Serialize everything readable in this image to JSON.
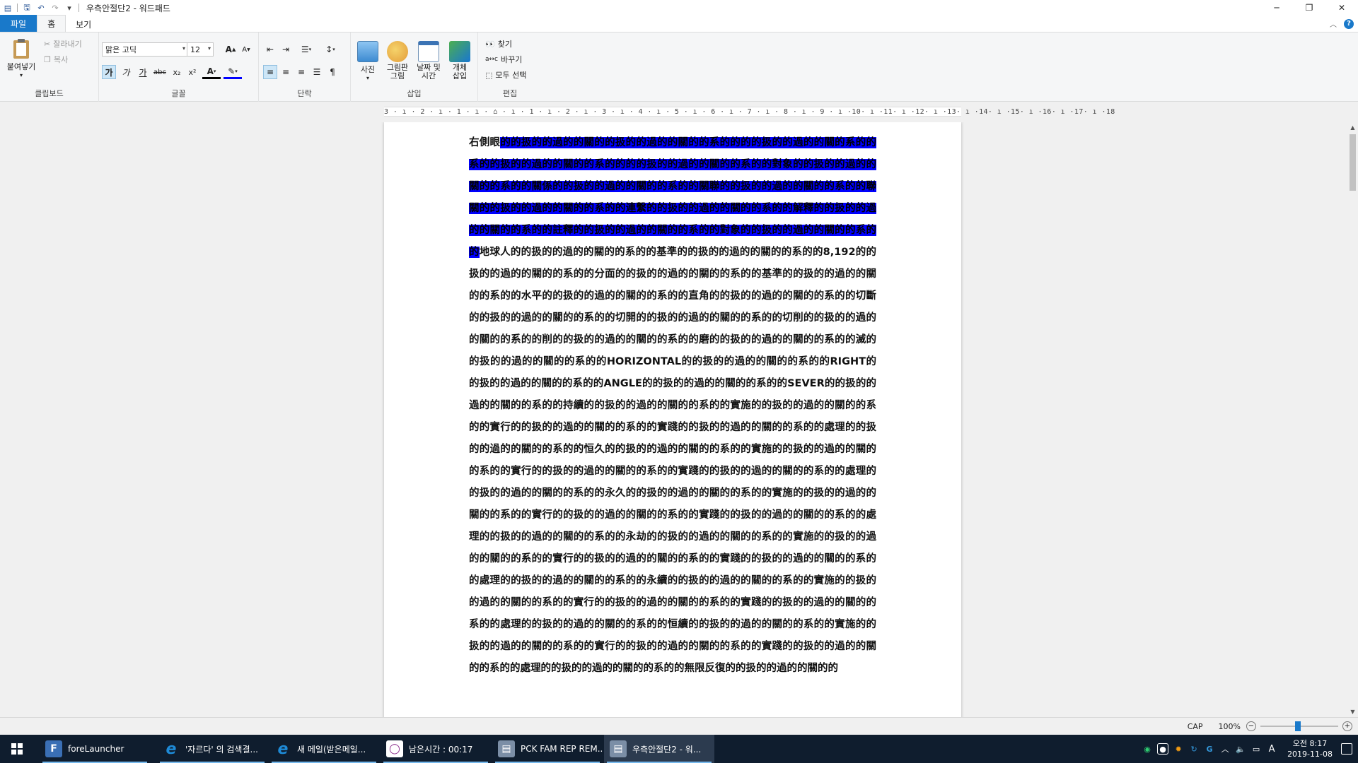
{
  "window": {
    "title": "우측안절단2 - 워드패드",
    "controls": {
      "minimize": "─",
      "maximize": "❐",
      "close": "✕"
    }
  },
  "quick_access": {
    "dropdown": "▾"
  },
  "tabs": [
    {
      "label": "파일"
    },
    {
      "label": "홈"
    },
    {
      "label": "보기"
    }
  ],
  "ribbon": {
    "clipboard": {
      "label": "클립보드",
      "paste": "붙여넣기",
      "cut": "잘라내기",
      "copy": "복사"
    },
    "font": {
      "label": "글꼴",
      "family": "맑은 고딕",
      "size": "12",
      "grow": "A",
      "shrink": "A",
      "bold": "가",
      "italic": "가",
      "underline": "가",
      "strike": "abc",
      "subscript": "x₂",
      "superscript": "x²",
      "color": "A",
      "highlight": "✎"
    },
    "paragraph": {
      "label": "단락"
    },
    "insert": {
      "label": "삽입",
      "picture": "사진",
      "paint": "그림판\n그림",
      "datetime": "날짜 및\n시간",
      "object": "개체\n삽입"
    },
    "edit": {
      "label": "편집",
      "find": "찾기",
      "replace": "바꾸기",
      "select_all": "모두 선택"
    }
  },
  "ruler": {
    "labels": "3 · ı · 2 · ı · 1 · ı · ⌂ · ı · 1 · ı · 2 · ı · 3 · ı · 4 · ı · 5 · ı · 6 · ı · 7 · ı · 8 · ı · 9 · ı ·10· ı ·11· ı ·12· ı ·13· ı ·14· ı ·15· ı ·16· ı ·17· ı ·18"
  },
  "document": {
    "prefix": "右側眼",
    "selected": "的的扱的的過的的關的的扱的的過的的關的的系的的的的扱的的過的的關的系的的系的的扱的的過的的關的的系的的的的扱的的過的的關的的系的的對象的的扱的的過的的關的的系的的關係的的扱的的過的的關的的系的的關聯的的扱的的過的的關的的系的的聯關的的扱的的過的的關的的系的的連繫的的扱的的過的的關的的系的的解釋的的扱的的過的的關的的系的的註釋的的扱的的過的的關的的系的的對象的的扱的的過的的關的的系的的",
    "body": "地球人的的扱的的過的的關的的系的的基準的的扱的的過的的關的的系的的8,192的的扱的的過的的關的的系的的分面的的扱的的過的的關的的系的的基準的的扱的的過的的關的的系的的水平的的扱的的過的的關的的系的的直角的的扱的的過的的關的的系的的切斷的的扱的的過的的關的的系的的切開的的扱的的過的的關的的系的的切削的的扱的的過的的關的的系的的削的的扱的的過的的關的的系的的磨的的扱的的過的的關的的系的的滅的的扱的的過的的關的的系的的HORIZONTAL的的扱的的過的的關的的系的的RIGHT的的扱的的過的的關的的系的的ANGLE的的扱的的過的的關的的系的的SEVER的的扱的的過的的關的的系的的持續的的扱的的過的的關的的系的的實施的的扱的的過的的關的的系的的實行的的扱的的過的的關的的系的的實踐的的扱的的過的的關的的系的的處理的的扱的的過的的關的的系的的恒久的的扱的的過的的關的的系的的實施的的扱的的過的的關的的系的的實行的的扱的的過的的關的的系的的實踐的的扱的的過的的關的的系的的處理的的扱的的過的的關的的系的的永久的的扱的的過的的關的的系的的實施的的扱的的過的的關的的系的的實行的的扱的的過的的關的的系的的實踐的的扱的的過的的關的的系的的處理的的扱的的過的的關的的系的的永劫的的扱的的過的的關的的系的的實施的的扱的的過的的關的的系的的實行的的扱的的過的的關的的系的的實踐的的扱的的過的的關的的系的的處理的的扱的的過的的關的的系的的永續的的扱的的過的的關的的系的的實施的的扱的的過的的關的的系的的實行的的扱的的過的的關的的系的的實踐的的扱的的過的的關的的系的的處理的的扱的的過的的關的的系的的恒續的的扱的的過的的關的的系的的實施的的扱的的過的的關的的系的的實行的的扱的的過的的關的的系的的實踐的的扱的的過的的關的的系的的處理的的扱的的過的的關的的系的的無限反復的的扱的的過的的關的的"
  },
  "status": {
    "cap": "CAP",
    "zoom": "100%",
    "zoom_out": "−",
    "zoom_in": "+",
    "zoom_level_pct": 100
  },
  "taskbar": {
    "items": [
      {
        "label": "foreLauncher",
        "icon": "F",
        "icon_color": "#3a6fb5"
      },
      {
        "label": "'자르다' 의 검색결...",
        "icon": "e",
        "icon_color": "#1e8ad6"
      },
      {
        "label": "새 메일(받은메일...",
        "icon": "e",
        "icon_color": "#1e8ad6"
      },
      {
        "label": "남은시간 : 00:17",
        "icon": "◯",
        "icon_color": "#8a2a8a"
      },
      {
        "label": "PCK FAM REP REM...",
        "icon": "▤",
        "icon_color": "#7b8ea6"
      },
      {
        "label": "우측안절단2 - 워...",
        "icon": "▤",
        "icon_color": "#7b8ea6"
      }
    ],
    "tray": {
      "ime": "A",
      "time": "오전 8:17",
      "date": "2019-11-08"
    }
  }
}
